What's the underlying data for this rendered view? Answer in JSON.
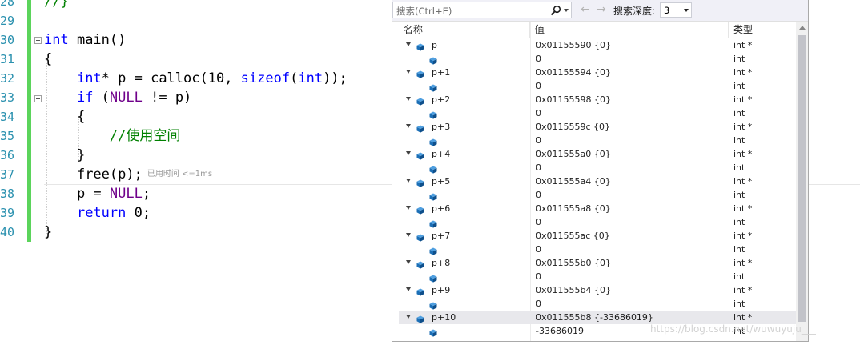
{
  "editor": {
    "line_numbers": [
      "28",
      "29",
      "30",
      "31",
      "32",
      "33",
      "34",
      "35",
      "36",
      "37",
      "38",
      "39",
      "40"
    ],
    "elapsed_hint": "已用时间 <=1ms",
    "code": {
      "l28": "//}",
      "l30_kw": "int",
      "l30_rest": " main()",
      "l31": "{",
      "l32_kw": "int",
      "l32_a": "* p = calloc(10, ",
      "l32_kw2": "sizeof",
      "l32_b": "(",
      "l32_kw3": "int",
      "l32_c": "));",
      "l33_kw": "if",
      "l33_a": " (",
      "l33_mac": "NULL",
      "l33_b": " != p)",
      "l34": "{",
      "l35": "//使用空间",
      "l36": "}",
      "l37": "free(p);",
      "l38_a": "p = ",
      "l38_mac": "NULL",
      "l38_b": ";",
      "l39_kw": "return",
      "l39_b": " 0;",
      "l40": "}"
    }
  },
  "watch": {
    "search_placeholder": "搜索(Ctrl+E)",
    "depth_label": "搜索深度:",
    "depth_value": "3",
    "columns": {
      "name": "名称",
      "value": "值",
      "type": "类型"
    },
    "rows": [
      {
        "name": "p",
        "value": "0x01155590 {0}",
        "type": "int *"
      },
      {
        "name": "",
        "value": "0",
        "type": "int"
      },
      {
        "name": "p+1",
        "value": "0x01155594 {0}",
        "type": "int *"
      },
      {
        "name": "",
        "value": "0",
        "type": "int"
      },
      {
        "name": "p+2",
        "value": "0x01155598 {0}",
        "type": "int *"
      },
      {
        "name": "",
        "value": "0",
        "type": "int"
      },
      {
        "name": "p+3",
        "value": "0x0115559c {0}",
        "type": "int *"
      },
      {
        "name": "",
        "value": "0",
        "type": "int"
      },
      {
        "name": "p+4",
        "value": "0x011555a0 {0}",
        "type": "int *"
      },
      {
        "name": "",
        "value": "0",
        "type": "int"
      },
      {
        "name": "p+5",
        "value": "0x011555a4 {0}",
        "type": "int *"
      },
      {
        "name": "",
        "value": "0",
        "type": "int"
      },
      {
        "name": "p+6",
        "value": "0x011555a8 {0}",
        "type": "int *"
      },
      {
        "name": "",
        "value": "0",
        "type": "int"
      },
      {
        "name": "p+7",
        "value": "0x011555ac {0}",
        "type": "int *"
      },
      {
        "name": "",
        "value": "0",
        "type": "int"
      },
      {
        "name": "p+8",
        "value": "0x011555b0 {0}",
        "type": "int *"
      },
      {
        "name": "",
        "value": "0",
        "type": "int"
      },
      {
        "name": "p+9",
        "value": "0x011555b4 {0}",
        "type": "int *"
      },
      {
        "name": "",
        "value": "0",
        "type": "int"
      },
      {
        "name": "p+10",
        "value": "0x011555b8 {-33686019}",
        "type": "int *"
      },
      {
        "name": "",
        "value": "-33686019",
        "type": "int"
      }
    ]
  },
  "watermark": "https://blog.csdn.net/wuwuyuju___",
  "colors": {
    "line_number": "#2b91af",
    "keyword": "#0000ff",
    "macro": "#6f008a",
    "comment": "#008000",
    "change_bar": "#5bd45b",
    "cube_icon": "#1c6fb6"
  }
}
